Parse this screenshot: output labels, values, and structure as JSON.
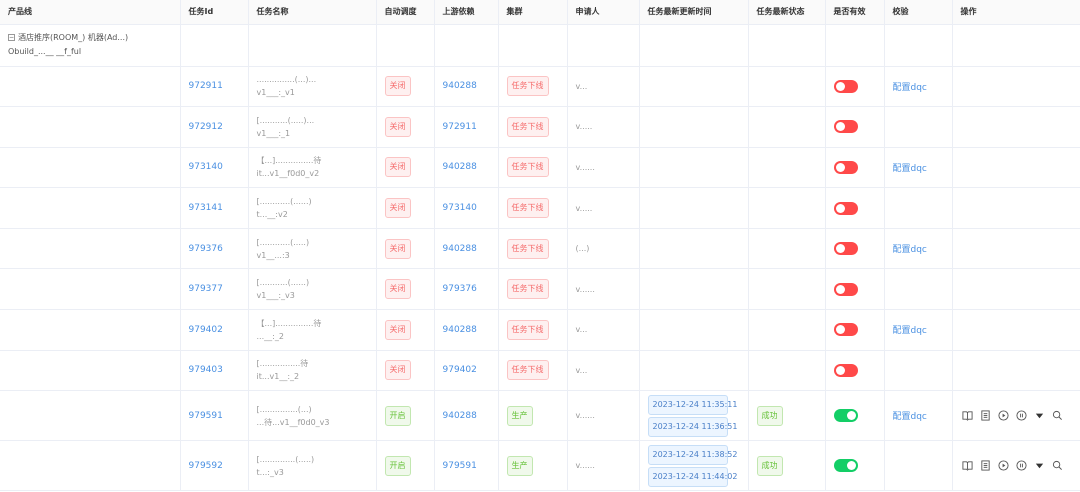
{
  "columns": [
    "产品线",
    "任务Id",
    "任务名称",
    "自动调度",
    "上游依赖",
    "集群",
    "申请人",
    "任务最新更新时间",
    "任务最新状态",
    "是否有效",
    "校验",
    "操作"
  ],
  "group": {
    "line1": "酒店推序(ROOM_) 机器(Ad...)",
    "line2": "Obuild_...__ __f_ful"
  },
  "rows": [
    {
      "id": "972911",
      "name1": "...............(...)...",
      "name2": "v1___:_v1",
      "auto": "关闭",
      "upstream": "940288",
      "cluster": "任务下线",
      "applicant": "v...",
      "times": [],
      "status": "",
      "valid": false,
      "check": "配置dqc",
      "ops": false
    },
    {
      "id": "972912",
      "name1": "[...........(.....)...",
      "name2": "v1___:_1",
      "auto": "关闭",
      "upstream": "972911",
      "cluster": "任务下线",
      "applicant": "v.....",
      "times": [],
      "status": "",
      "valid": false,
      "check": "",
      "ops": false
    },
    {
      "id": "973140",
      "name1": "【...]...............待",
      "name2": "it...v1__f0d0_v2",
      "auto": "关闭",
      "upstream": "940288",
      "cluster": "任务下线",
      "applicant": "v......",
      "times": [],
      "status": "",
      "valid": false,
      "check": "配置dqc",
      "ops": false
    },
    {
      "id": "973141",
      "name1": "[............(......)",
      "name2": "t...__:v2",
      "auto": "关闭",
      "upstream": "973140",
      "cluster": "任务下线",
      "applicant": "v.....",
      "times": [],
      "status": "",
      "valid": false,
      "check": "",
      "ops": false
    },
    {
      "id": "979376",
      "name1": "[............(.....)",
      "name2": "v1__...:3",
      "auto": "关闭",
      "upstream": "940288",
      "cluster": "任务下线",
      "applicant": "(...)",
      "times": [],
      "status": "",
      "valid": false,
      "check": "配置dqc",
      "ops": false
    },
    {
      "id": "979377",
      "name1": "[...........(......)",
      "name2": "v1___:_v3",
      "auto": "关闭",
      "upstream": "979376",
      "cluster": "任务下线",
      "applicant": "v......",
      "times": [],
      "status": "",
      "valid": false,
      "check": "",
      "ops": false
    },
    {
      "id": "979402",
      "name1": "【...]...............待",
      "name2": "...__:_2",
      "auto": "关闭",
      "upstream": "940288",
      "cluster": "任务下线",
      "applicant": "v...",
      "times": [],
      "status": "",
      "valid": false,
      "check": "配置dqc",
      "ops": false
    },
    {
      "id": "979403",
      "name1": "[................待",
      "name2": "it...v1__:_2",
      "auto": "关闭",
      "upstream": "979402",
      "cluster": "任务下线",
      "applicant": "v...",
      "times": [],
      "status": "",
      "valid": false,
      "check": "",
      "ops": false
    },
    {
      "id": "979591",
      "name1": "[...............(...)",
      "name2": "...待...v1__f0d0_v3",
      "auto": "开启",
      "upstream": "940288",
      "cluster": "生产",
      "applicant": "v......",
      "times": [
        "2023-12-24 11:35:11",
        "2023-12-24 11:36:51"
      ],
      "status": "成功",
      "valid": true,
      "check": "配置dqc",
      "ops": true
    },
    {
      "id": "979592",
      "name1": "[..............(.....)",
      "name2": "t...:_v3",
      "auto": "开启",
      "upstream": "979591",
      "cluster": "生产",
      "applicant": "v......",
      "times": [
        "2023-12-24 11:38:52",
        "2023-12-24 11:44:02"
      ],
      "status": "成功",
      "valid": true,
      "check": "",
      "ops": true
    }
  ],
  "icons": [
    "book-icon",
    "document-icon",
    "play-icon",
    "pause-icon",
    "caret-down-icon",
    "search-icon"
  ],
  "colors": {
    "link": "#4a90e2",
    "toggle_off": "#ff4949",
    "toggle_on": "#13ce66",
    "tag_red": "#f56c6c",
    "tag_green": "#67c23a"
  }
}
